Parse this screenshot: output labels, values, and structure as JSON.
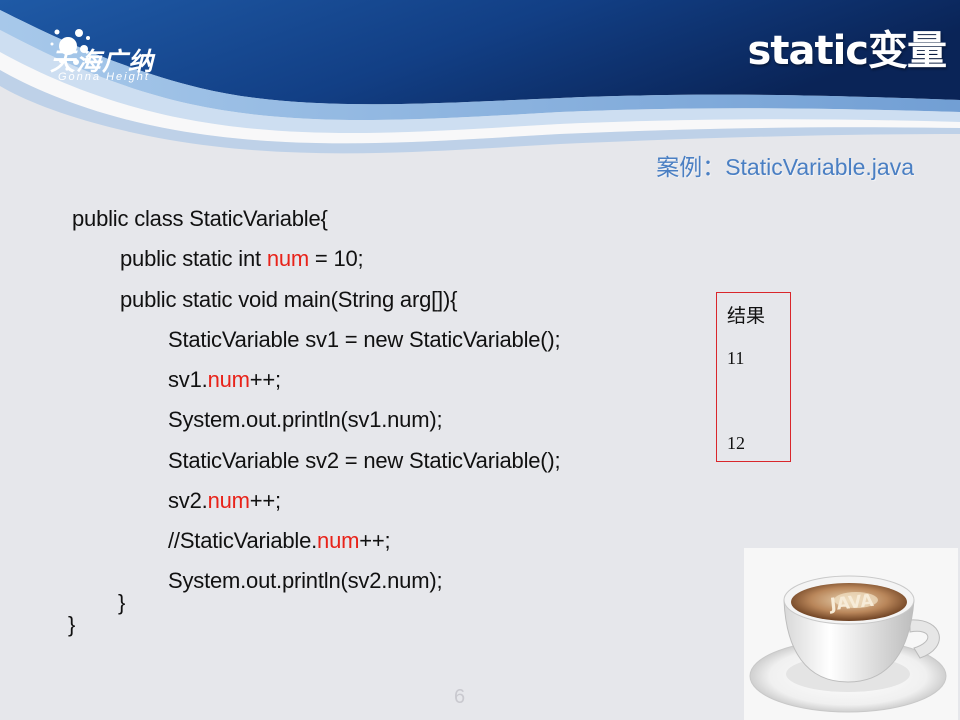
{
  "header": {
    "logo_cn": "天海广纳",
    "logo_en": "Gonna Height",
    "title": "static变量"
  },
  "subtitle": "案例：StaticVariable.java",
  "code": {
    "l1": "public class StaticVariable{",
    "l2a": "public static int ",
    "l2b": "num",
    "l2c": " = 10;",
    "l3": "public static void main(String arg[]){",
    "l4": "StaticVariable sv1 = new StaticVariable();",
    "l5a": "sv1.",
    "l5b": "num",
    "l5c": "++;",
    "l6": "System.out.println(sv1.num);",
    "l7": "StaticVariable sv2 = new StaticVariable();",
    "l8a": "sv2.",
    "l8b": "num",
    "l8c": "++;",
    "l9a": "//StaticVariable.",
    "l9b": "num",
    "l9c": "++;",
    "l10": "System.out.println(sv2.num);",
    "l11": "}",
    "l12": "}"
  },
  "result": {
    "title": "结果",
    "values": [
      "11",
      "12"
    ]
  },
  "image": {
    "cup_label": "JAVA"
  },
  "page_number": "6",
  "colors": {
    "header_dark": "#0d2f6b",
    "header_mid": "#2f6cb3",
    "highlight": "#e8231a",
    "subtitle": "#4a7fc3",
    "box_border": "#d9262b"
  }
}
